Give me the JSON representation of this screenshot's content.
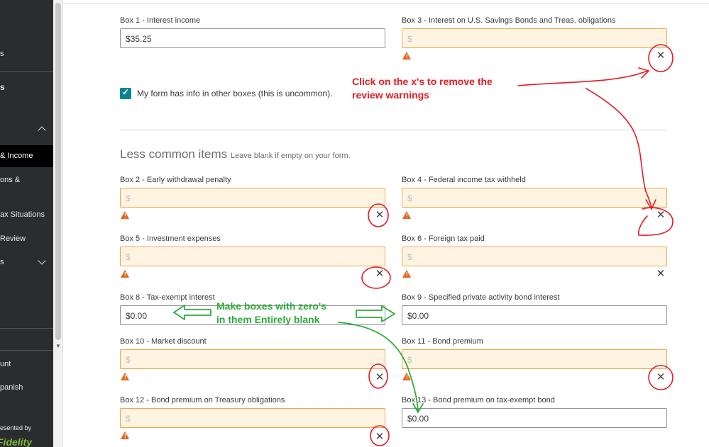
{
  "sidebar": {
    "items": [
      {
        "label": "s"
      },
      {
        "label": "s"
      },
      {
        "label": "& Income"
      },
      {
        "label": "ons &"
      },
      {
        "label": "ax Situations"
      },
      {
        "label": "Review"
      },
      {
        "label": "s"
      },
      {
        "label": "unt"
      },
      {
        "label": "panish"
      },
      {
        "label": "esented by"
      }
    ],
    "sponsor_logo": "Fidelity"
  },
  "form": {
    "checkbox_label": "My form has info in other boxes (this is uncommon).",
    "section_title": "Less common items",
    "section_subtitle": "Leave blank if empty on your form.",
    "fields": [
      {
        "label": "Box 1 - Interest income",
        "value": "$35.25"
      },
      {
        "label": "Box 3 - Interest on U.S. Savings Bonds and Treas. obligations",
        "placeholder": "$"
      },
      {
        "label": "Box 2 - Early withdrawal penalty",
        "placeholder": "$"
      },
      {
        "label": "Box 4 - Federal income tax withheld",
        "placeholder": "$"
      },
      {
        "label": "Box 5 - Investment expenses",
        "placeholder": "$"
      },
      {
        "label": "Box 6 - Foreign tax paid",
        "placeholder": "$"
      },
      {
        "label": "Box 8 - Tax-exempt interest",
        "value": "$0.00"
      },
      {
        "label": "Box 9 - Specified private activity bond interest",
        "value": "$0.00"
      },
      {
        "label": "Box 10 - Market discount",
        "placeholder": "$"
      },
      {
        "label": "Box 11 - Bond premium",
        "placeholder": "$"
      },
      {
        "label": "Box 12 - Bond premium on Treasury obligations",
        "placeholder": "$"
      },
      {
        "label": "Box 13 - Bond premium on tax-exempt bond",
        "value": "$0.00"
      }
    ]
  },
  "annotations": {
    "red_line1": "Click on the x's to remove the",
    "red_line2": "review warnings",
    "green_line1": "Make boxes with zero's",
    "green_line2": "in them Entirely blank"
  },
  "colors": {
    "warning_orange": "#e8641b",
    "warning_field_bg": "#fff4e2",
    "checkbox_teal": "#0d8390",
    "annotation_red": "#e31b23",
    "annotation_green": "#2dac3a"
  }
}
